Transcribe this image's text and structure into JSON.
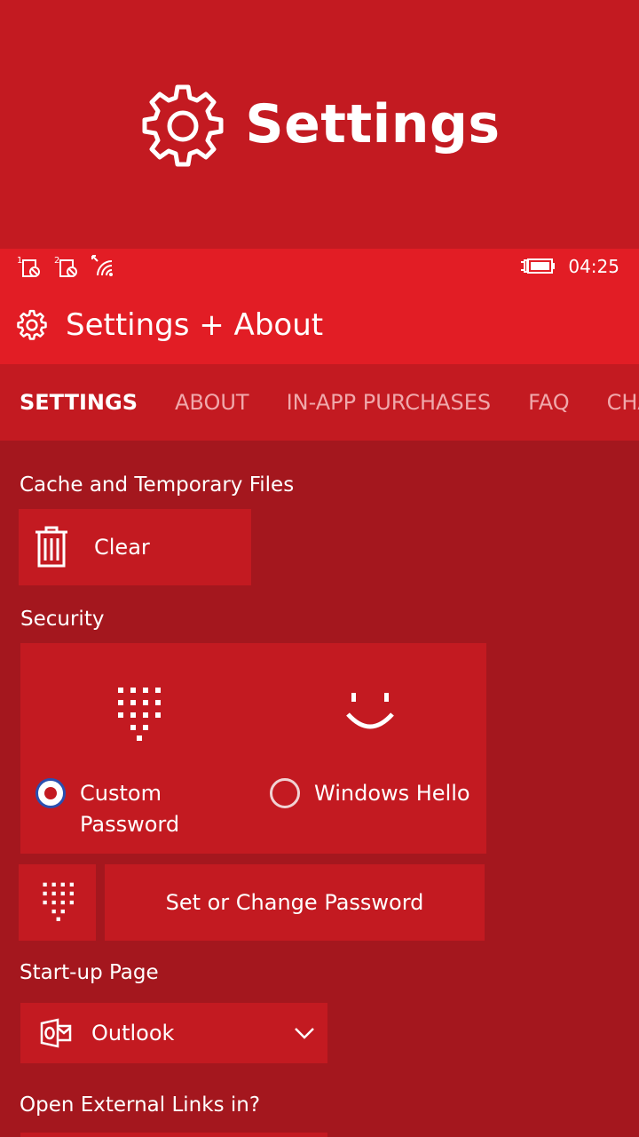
{
  "banner": {
    "title": "Settings",
    "icon": "gear-icon"
  },
  "statusbar": {
    "time": "04:25",
    "sim1": "1",
    "sim2": "2",
    "icons": [
      "sim1-no-signal-icon",
      "sim2-no-signal-icon",
      "wifi-icon",
      "battery-charging-icon"
    ]
  },
  "appbar": {
    "title": "Settings + About",
    "icon": "gear-icon"
  },
  "tabs": [
    {
      "label": "SETTINGS",
      "active": true
    },
    {
      "label": "ABOUT",
      "active": false
    },
    {
      "label": "IN-APP PURCHASES",
      "active": false
    },
    {
      "label": "FAQ",
      "active": false
    },
    {
      "label": "CHA",
      "active": false
    }
  ],
  "cache": {
    "heading": "Cache and Temporary Files",
    "button_label": "Clear",
    "icon": "trash-icon"
  },
  "security": {
    "heading": "Security",
    "option_password_line1": "Custom",
    "option_password_line2": "Password",
    "option_hello": "Windows Hello",
    "selected": "Custom Password",
    "change_button_label": "Set or Change Password"
  },
  "startup": {
    "heading": "Start-up Page",
    "selected_value": "Outlook",
    "icon": "outlook-icon"
  },
  "external_links": {
    "heading": "Open External Links in?"
  },
  "colors": {
    "banner": "#c31a21",
    "appbar": "#e21d25",
    "page": "#a4171e",
    "accent_radio": "#2b4fb0"
  }
}
